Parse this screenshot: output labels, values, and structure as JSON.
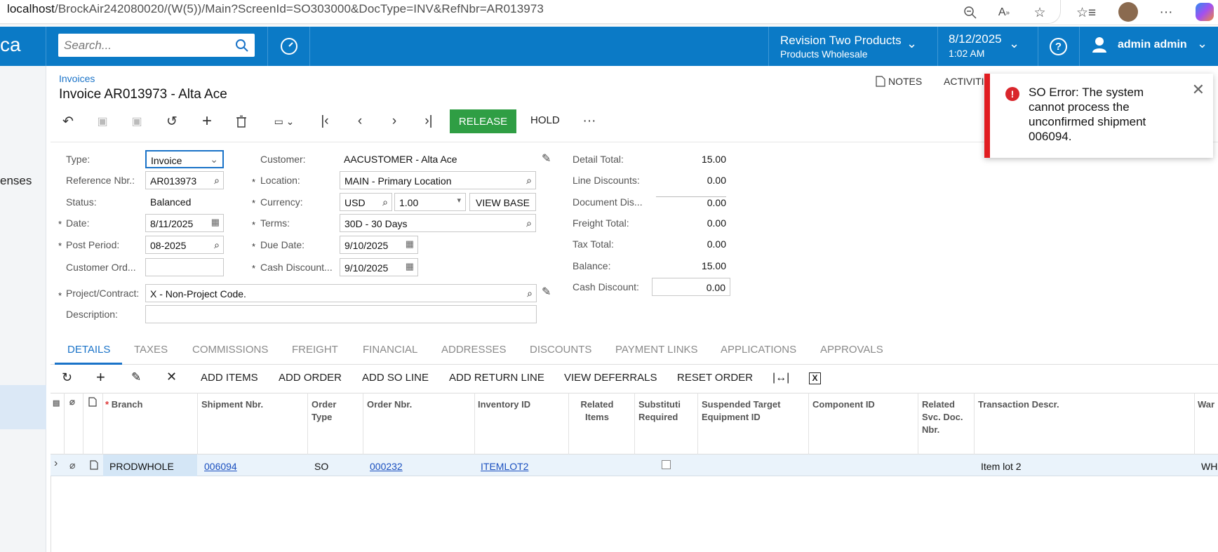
{
  "browser": {
    "url_host": "localhost",
    "url_path": "/BrockAir242080020/(W(5))/Main?ScreenId=SO303000&DocType=INV&RefNbr=AR013973"
  },
  "header": {
    "logo_fragment": "ca",
    "search_placeholder": "Search...",
    "company": "Revision Two Products",
    "branch": "Products Wholesale",
    "date": "8/12/2025",
    "time": "1:02 AM",
    "user": "admin admin",
    "accent": "#0b7ac6"
  },
  "sidebar": {
    "partial_label": "enses"
  },
  "page": {
    "breadcrumb": "Invoices",
    "title": "Invoice AR013973 - Alta Ace",
    "notes": "NOTES",
    "activities": "ACTIVITI",
    "release": "RELEASE",
    "hold": "HOLD"
  },
  "form": {
    "type_label": "Type:",
    "type_value": "Invoice",
    "ref_label": "Reference Nbr.:",
    "ref_value": "AR013973",
    "status_label": "Status:",
    "status_value": "Balanced",
    "date_label": "Date:",
    "date_value": "8/11/2025",
    "post_label": "Post Period:",
    "post_value": "08-2025",
    "custord_label": "Customer Ord...",
    "custord_value": "",
    "project_label": "Project/Contract:",
    "project_value": "X - Non-Project Code.",
    "desc_label": "Description:",
    "desc_value": "",
    "customer_label": "Customer:",
    "customer_value": "AACUSTOMER - Alta Ace",
    "location_label": "Location:",
    "location_value": "MAIN - Primary Location",
    "currency_label": "Currency:",
    "currency_value": "USD",
    "rate_value": "1.00",
    "viewbase": "VIEW BASE",
    "terms_label": "Terms:",
    "terms_value": "30D - 30 Days",
    "due_label": "Due Date:",
    "due_value": "9/10/2025",
    "cashdisc_label": "Cash Discount...",
    "cashdisc_value": "9/10/2025"
  },
  "totals": [
    {
      "label": "Detail Total:",
      "value": "15.00"
    },
    {
      "label": "Line Discounts:",
      "value": "0.00"
    },
    {
      "label": "Document Dis...",
      "value": "0.00"
    },
    {
      "label": "Freight Total:",
      "value": "0.00"
    },
    {
      "label": "Tax Total:",
      "value": "0.00"
    },
    {
      "label": "Balance:",
      "value": "15.00"
    },
    {
      "label": "Cash Discount:",
      "value": "0.00"
    }
  ],
  "tabs": [
    "DETAILS",
    "TAXES",
    "COMMISSIONS",
    "FREIGHT",
    "FINANCIAL",
    "ADDRESSES",
    "DISCOUNTS",
    "PAYMENT LINKS",
    "APPLICATIONS",
    "APPROVALS"
  ],
  "grid_toolbar": [
    "ADD ITEMS",
    "ADD ORDER",
    "ADD SO LINE",
    "ADD RETURN LINE",
    "VIEW DEFERRALS",
    "RESET ORDER"
  ],
  "columns": {
    "branch": "Branch",
    "shipment": "Shipment Nbr.",
    "order_type": "Order Type",
    "order_nbr": "Order Nbr.",
    "inventory": "Inventory ID",
    "related": "Related Items",
    "subst": "Substituti Required",
    "suspended": "Suspended Target Equipment ID",
    "component": "Component ID",
    "related_svc": "Related Svc. Doc. Nbr.",
    "descr": "Transaction Descr.",
    "war": "War"
  },
  "row": {
    "branch": "PRODWHOLE",
    "shipment": "006094",
    "order_type": "SO",
    "order_nbr": "000232",
    "inventory": "ITEMLOT2",
    "descr": "Item lot 2",
    "war": "WH"
  },
  "toast": {
    "message": "SO Error: The system cannot process the unconfirmed shipment 006094.",
    "color": "#e11d21"
  }
}
